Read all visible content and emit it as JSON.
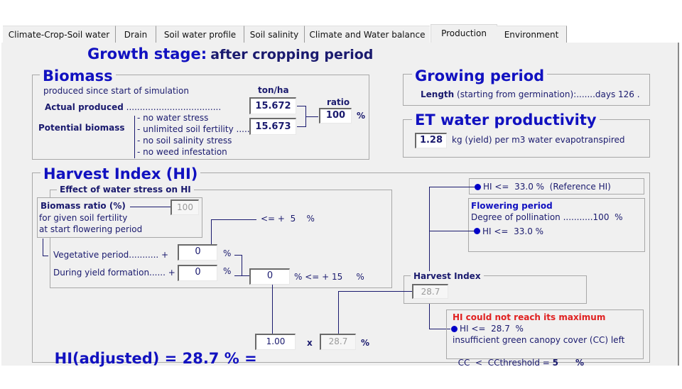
{
  "tabs": [
    {
      "label": "Climate-Crop-Soil water",
      "active": false
    },
    {
      "label": "Drain",
      "active": false
    },
    {
      "label": "Soil water profile",
      "active": false
    },
    {
      "label": "Soil salinity",
      "active": false
    },
    {
      "label": "Climate and Water balance",
      "active": false
    },
    {
      "label": "Production",
      "active": true
    },
    {
      "label": "Environment",
      "active": false
    }
  ],
  "header": {
    "label": "Growth stage:",
    "value": "after cropping period"
  },
  "biomass": {
    "title": "Biomass",
    "subtitle": "produced since start of simulation",
    "unit_label": "ton/ha",
    "ratio_label": "ratio",
    "actual_label": "Actual produced",
    "actual_dots": "...................................",
    "actual_value": "15.672",
    "potential_label": "Potential biomass",
    "conditions": [
      "- no water stress",
      "- unlimited soil fertility",
      "- no soil salinity stress",
      "- no weed infestation"
    ],
    "potential_dots": "......",
    "potential_value": "15.673",
    "ratio_value": "100",
    "ratio_unit": "%"
  },
  "growing_period": {
    "title": "Growing period",
    "length_label": "Length",
    "length_desc": "(starting from germination):.......days 126 ."
  },
  "et_productivity": {
    "title": "ET water productivity",
    "value": "1.28",
    "unit": "kg (yield) per m3 water evapotranspired"
  },
  "harvest_index": {
    "title": "Harvest Index (HI)",
    "water_stress": {
      "title": "Effect of water stress on HI",
      "biomass_ratio_label": "Biomass ratio (%)",
      "biomass_ratio_desc1": "for given soil fertility",
      "biomass_ratio_desc2": "at start flowering period",
      "biomass_ratio_value": "100",
      "limit1": "<= +  5    %",
      "vegetative_label": "Vegetative period........... +",
      "vegetative_value": "0",
      "yield_label": "During yield formation...... +",
      "yield_value": "0",
      "pct": "%",
      "total_value": "0",
      "limit2": "% <= + 15     %"
    },
    "reference_hi": "HI <=  33.0 %  (Reference HI)",
    "flowering": {
      "title": "Flowering period",
      "pollination": "Degree of pollination ...........100  %",
      "hi": "HI <=  33.0 %"
    },
    "harvest_index_box": {
      "title": "Harvest Index",
      "value": "28.7"
    },
    "warning": {
      "title": "HI could not reach its maximum",
      "hi": "HI <=  28.7  %",
      "reason": "insufficient green canopy cover (CC) left",
      "cc_prefix": "CC  <  CCthreshold = ",
      "cc_value": "5",
      "cc_unit": "%"
    },
    "adjusted": {
      "label": "HI(adjusted) = ",
      "value": "28.7",
      "pct_eq": " % = ",
      "factor": "1.00",
      "times": "x",
      "hi_value": "28.7",
      "unit": "%"
    }
  }
}
